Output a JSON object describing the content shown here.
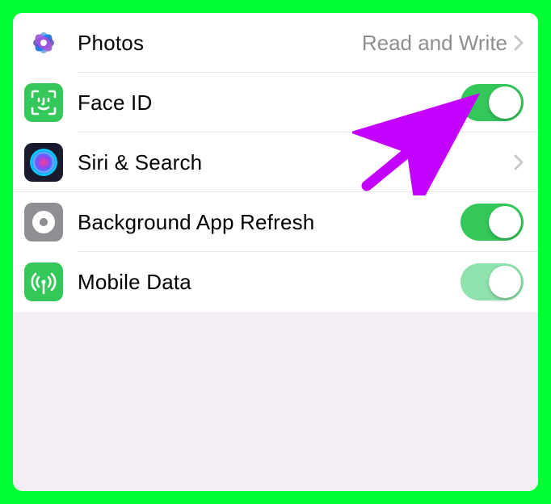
{
  "rows": [
    {
      "id": "photos",
      "label": "Photos",
      "detail": "Read and Write",
      "icon": "photos-icon",
      "accessory": "disclosure"
    },
    {
      "id": "face-id",
      "label": "Face ID",
      "icon": "face-id-icon",
      "accessory": "toggle",
      "toggle_state": "on"
    },
    {
      "id": "siri-search",
      "label": "Siri & Search",
      "icon": "siri-icon",
      "accessory": "disclosure"
    },
    {
      "id": "background-app-refresh",
      "label": "Background App Refresh",
      "icon": "gear-icon",
      "accessory": "toggle",
      "toggle_state": "on"
    },
    {
      "id": "mobile-data",
      "label": "Mobile Data",
      "icon": "antenna-icon",
      "accessory": "toggle",
      "toggle_state": "on-faded"
    }
  ],
  "annotation": {
    "purpose": "arrow pointing to Face ID toggle",
    "color": "#c400ff"
  },
  "colors": {
    "toggle_on": "#34c759",
    "toggle_on_faded": "#8fe2ac",
    "detail_text": "#8e8e93",
    "frame": "#00ff33"
  }
}
